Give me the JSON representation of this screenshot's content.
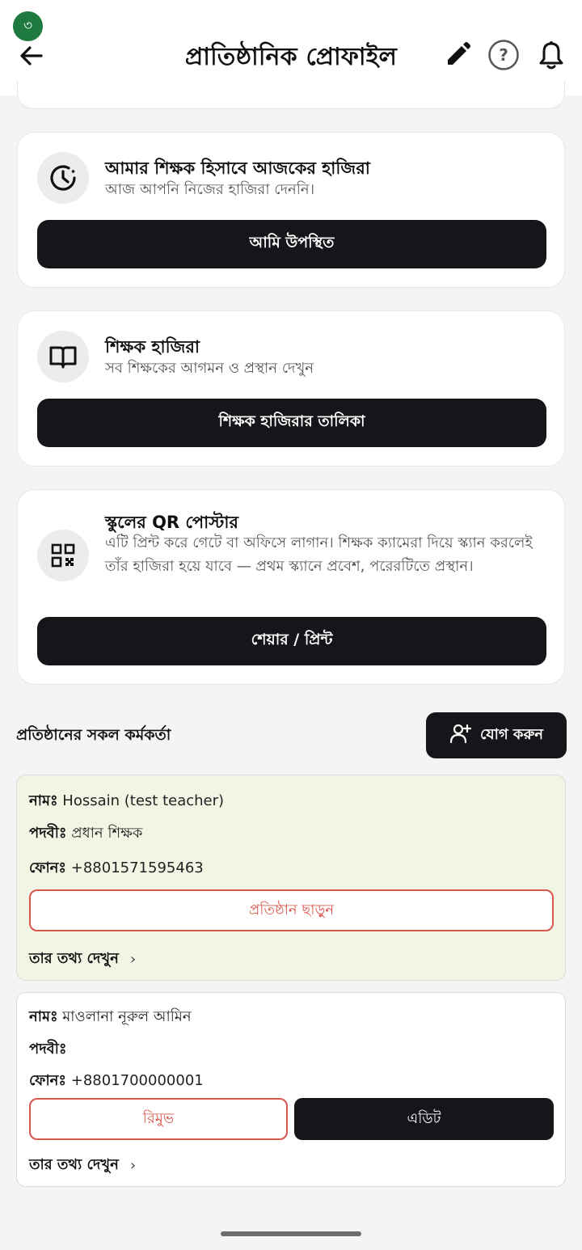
{
  "header": {
    "badge": "৩",
    "title": "প্রাতিষ্ঠানিক প্রোফাইল",
    "help_glyph": "?",
    "icons": [
      "back-arrow-icon",
      "pencil-icon",
      "help-icon",
      "bell-icon"
    ]
  },
  "attendance_card": {
    "title": "আমার শিক্ষক হিসাবে আজকের হাজিরা",
    "subtitle": "আজ আপনি নিজের হাজিরা দেননি।",
    "button": "আমি উপস্থিত",
    "icon": "clock-icon"
  },
  "teacher_attendance_card": {
    "title": "শিক্ষক হাজিরা",
    "subtitle": "সব শিক্ষকের আগমন ও প্রস্থান দেখুন",
    "button": "শিক্ষক হাজিরার তালিকা",
    "icon": "book-icon"
  },
  "qr_card": {
    "title": "স্কুলের QR পোস্টার",
    "subtitle": "এটি প্রিন্ট করে গেটে বা অফিসে লাগান। শিক্ষক ক্যামেরা দিয়ে স্ক্যান করলেই তাঁর হাজিরা হয়ে যাবে — প্রথম স্ক্যানে প্রবেশ, পরেরটিতে প্রস্থান।",
    "button": "শেয়ার / প্রিন্ট",
    "icon": "qr-code-icon"
  },
  "staff_section": {
    "title": "প্রতিষ্ঠানের সকল কর্মকর্তা",
    "add_button": "যোগ করুন",
    "add_icon": "add-user-icon"
  },
  "staff": [
    {
      "name_label": "নামঃ",
      "name": "Hossain (test teacher)",
      "designation_label": "পদবীঃ",
      "designation": "প্রধান শিক্ষক",
      "phone_label": "ফোনঃ",
      "phone": "+8801571595463",
      "leave_button": "প্রতিষ্ঠান ছাড়ুন",
      "info_link": "তার তথ্য দেখুন",
      "chevron": "›",
      "highlight_color": "#f1f5e4"
    },
    {
      "name_label": "নামঃ",
      "name": "মাওলানা নূরুল আমিন",
      "designation_label": "পদবীঃ",
      "designation": "",
      "phone_label": "ফোনঃ",
      "phone": "+8801700000001",
      "remove_button": "রিমুভ",
      "edit_button": "এডিট",
      "info_link": "তার তথ্য দেখুন",
      "chevron": "›"
    }
  ],
  "colors": {
    "accent_dark": "#14161a",
    "danger": "#d9564c",
    "badge_green": "#1f7a3f"
  }
}
